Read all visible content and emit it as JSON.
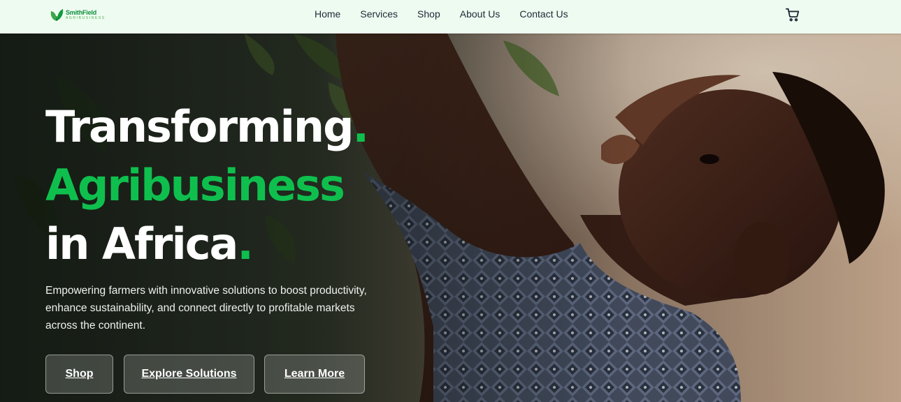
{
  "brand": {
    "name": "SmithField",
    "tagline": "AGRIBUSINESS",
    "accent_color": "#0fbf4e"
  },
  "nav": {
    "items": [
      "Home",
      "Services",
      "Shop",
      "About Us",
      "Contact Us"
    ],
    "cart_icon": "shopping-cart-icon"
  },
  "hero": {
    "line1": "Transforming",
    "line2": "Agribusiness",
    "line3": "in Africa",
    "dot": ".",
    "description": "Empowering farmers with innovative solutions to boost productivity, enhance sustainability, and connect directly to profitable markets across the continent.",
    "buttons": {
      "shop": "Shop",
      "explore": "Explore Solutions",
      "learn": "Learn More"
    }
  }
}
